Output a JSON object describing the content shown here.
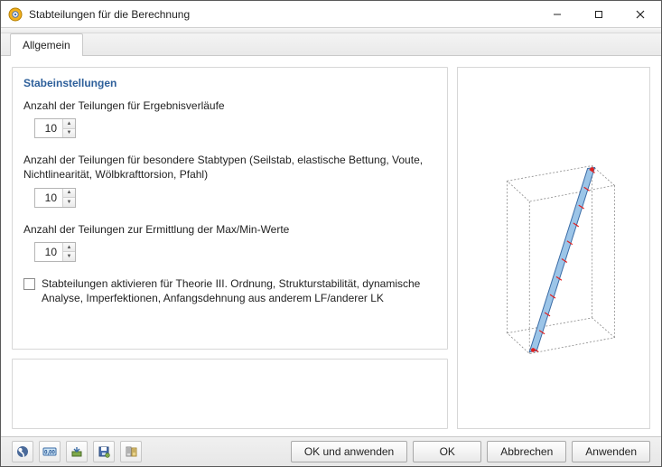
{
  "window": {
    "title": "Stabteilungen für die Berechnung"
  },
  "tabs": {
    "general": "Allgemein"
  },
  "section": {
    "title": "Stabeinstellungen"
  },
  "fields": {
    "divisions_results": {
      "label": "Anzahl der Teilungen für Ergebnisverläufe",
      "value": "10"
    },
    "divisions_special": {
      "label": "Anzahl der Teilungen für besondere Stabtypen (Seilstab, elastische Bettung, Voute, Nichtlinearität, Wölbkrafttorsion, Pfahl)",
      "value": "10"
    },
    "divisions_maxmin": {
      "label": "Anzahl der Teilungen zur Ermittlung der Max/Min-Werte",
      "value": "10"
    },
    "activate_checkbox": {
      "label": "Stabteilungen aktivieren für Theorie III. Ordnung, Strukturstabilität, dynamische Analyse, Imperfektionen, Anfangsdehnung aus anderem LF/anderer LK",
      "checked": false
    }
  },
  "toolbar_icons": {
    "help": "help-icon",
    "units": "units-icon",
    "load": "load-icon",
    "save": "save-icon",
    "defaults": "defaults-icon"
  },
  "buttons": {
    "ok_apply": "OK und anwenden",
    "ok": "OK",
    "cancel": "Abbrechen",
    "apply": "Anwenden"
  }
}
